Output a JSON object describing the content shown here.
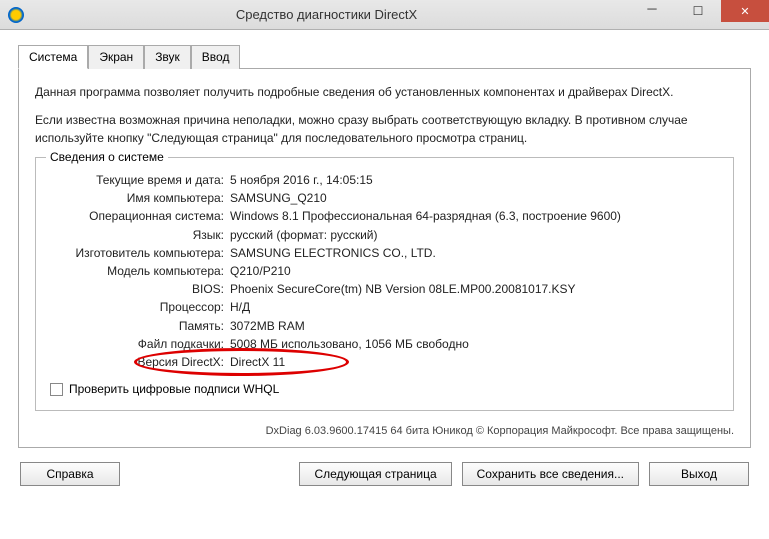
{
  "window": {
    "title": "Средство диагностики DirectX"
  },
  "tabs": {
    "t0": "Система",
    "t1": "Экран",
    "t2": "Звук",
    "t3": "Ввод"
  },
  "description": {
    "p1": "Данная программа позволяет получить подробные сведения об установленных компонентах и драйверах DirectX.",
    "p2": "Если известна возможная причина неполадки, можно сразу выбрать соответствующую вкладку. В противном случае используйте кнопку \"Следующая страница\" для последовательного просмотра страниц."
  },
  "sysinfo": {
    "legend": "Сведения о системе",
    "rows": {
      "datetime": {
        "label": "Текущие время и дата:",
        "value": "5 ноября 2016 г., 14:05:15"
      },
      "pcname": {
        "label": "Имя компьютера:",
        "value": "SAMSUNG_Q210"
      },
      "os": {
        "label": "Операционная система:",
        "value": "Windows 8.1 Профессиональная 64-разрядная (6.3, построение 9600)"
      },
      "lang": {
        "label": "Язык:",
        "value": "русский (формат: русский)"
      },
      "mfr": {
        "label": "Изготовитель компьютера:",
        "value": "SAMSUNG ELECTRONICS CO., LTD."
      },
      "model": {
        "label": "Модель компьютера:",
        "value": "Q210/P210"
      },
      "bios": {
        "label": "BIOS:",
        "value": "Phoenix SecureCore(tm) NB Version 08LE.MP00.20081017.KSY"
      },
      "cpu": {
        "label": "Процессор:",
        "value": "Н/Д"
      },
      "mem": {
        "label": "Память:",
        "value": "3072MB RAM"
      },
      "page": {
        "label": "Файл подкачки:",
        "value": "5008 МБ использовано, 1056 МБ свободно"
      },
      "dx": {
        "label": "Версия DirectX:",
        "value": "DirectX 11"
      }
    },
    "whql": "Проверить цифровые подписи WHQL"
  },
  "footer": "DxDiag 6.03.9600.17415 64 бита Юникод © Корпорация Майкрософт. Все права защищены.",
  "buttons": {
    "help": "Справка",
    "next": "Следующая страница",
    "save": "Сохранить все сведения...",
    "exit": "Выход"
  }
}
